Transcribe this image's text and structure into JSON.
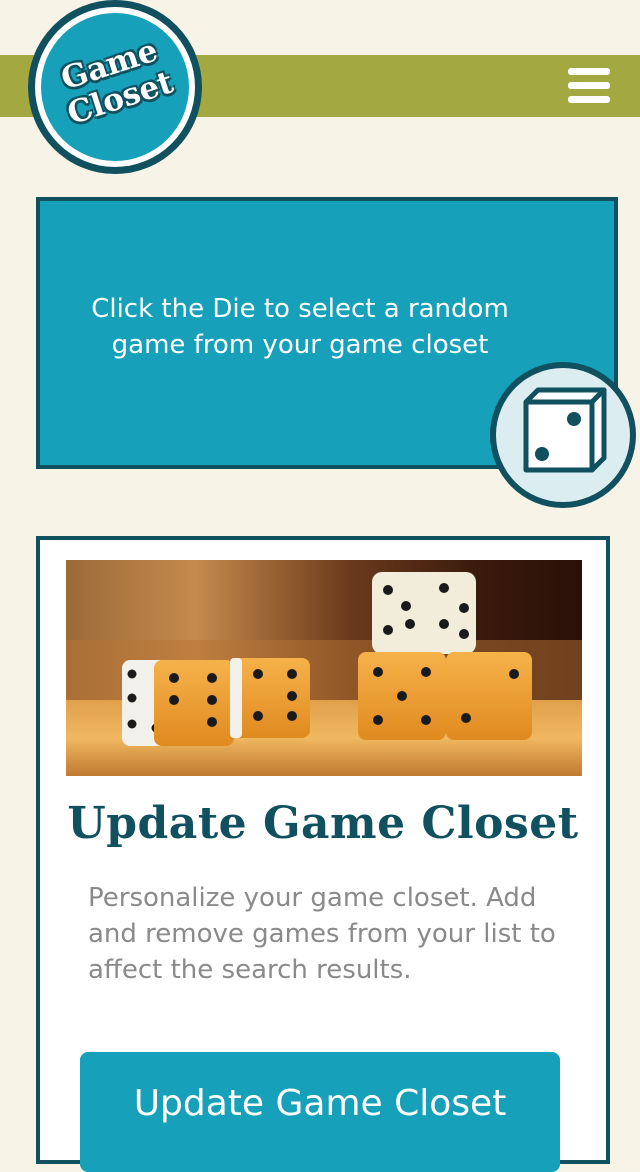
{
  "header": {
    "logo_line1": "Game",
    "logo_line2": "Closet",
    "menu_icon": "hamburger-menu-icon"
  },
  "random_panel": {
    "text": "Click the Die to select a random game from your game closet",
    "die_icon": "die-icon"
  },
  "update_card": {
    "image_alt": "dice on a table",
    "title": "Update Game Closet",
    "description": "Personalize your game closet. Add and remove games from your list to affect the search results.",
    "button_label": "Update Game Closet"
  },
  "colors": {
    "background": "#f7f3e6",
    "header_bar": "#a3a840",
    "teal": "#17a0b9",
    "dark_teal": "#10505f",
    "muted_text": "#8a8a8a"
  }
}
